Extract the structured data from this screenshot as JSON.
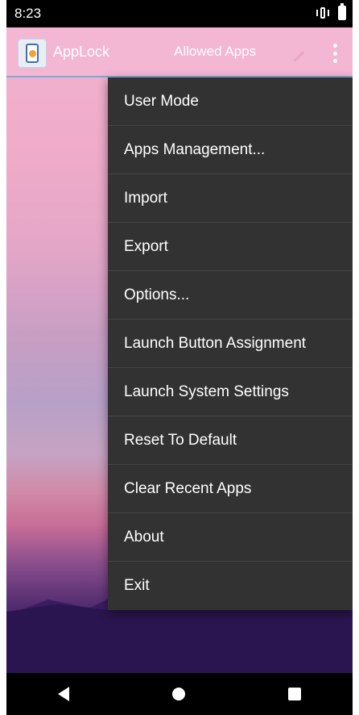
{
  "status_bar": {
    "time": "8:23"
  },
  "app_bar": {
    "title": "AppLock",
    "subtitle": "Allowed Apps"
  },
  "menu": {
    "items": [
      {
        "label": "User Mode"
      },
      {
        "label": "Apps Management..."
      },
      {
        "label": "Import"
      },
      {
        "label": "Export"
      },
      {
        "label": "Options..."
      },
      {
        "label": "Launch Button Assignment"
      },
      {
        "label": "Launch System Settings"
      },
      {
        "label": "Reset To Default"
      },
      {
        "label": "Clear Recent Apps"
      },
      {
        "label": "About"
      },
      {
        "label": "Exit"
      }
    ]
  },
  "colors": {
    "appbar": "#f3b6d3",
    "menu_bg": "#323232",
    "accent_line": "#7fa7d8"
  },
  "icons": {
    "logo": "applock-logo-icon",
    "edit": "edit-icon",
    "overflow": "overflow-menu-icon",
    "back": "back-icon",
    "home": "home-icon",
    "recents": "recents-icon"
  }
}
